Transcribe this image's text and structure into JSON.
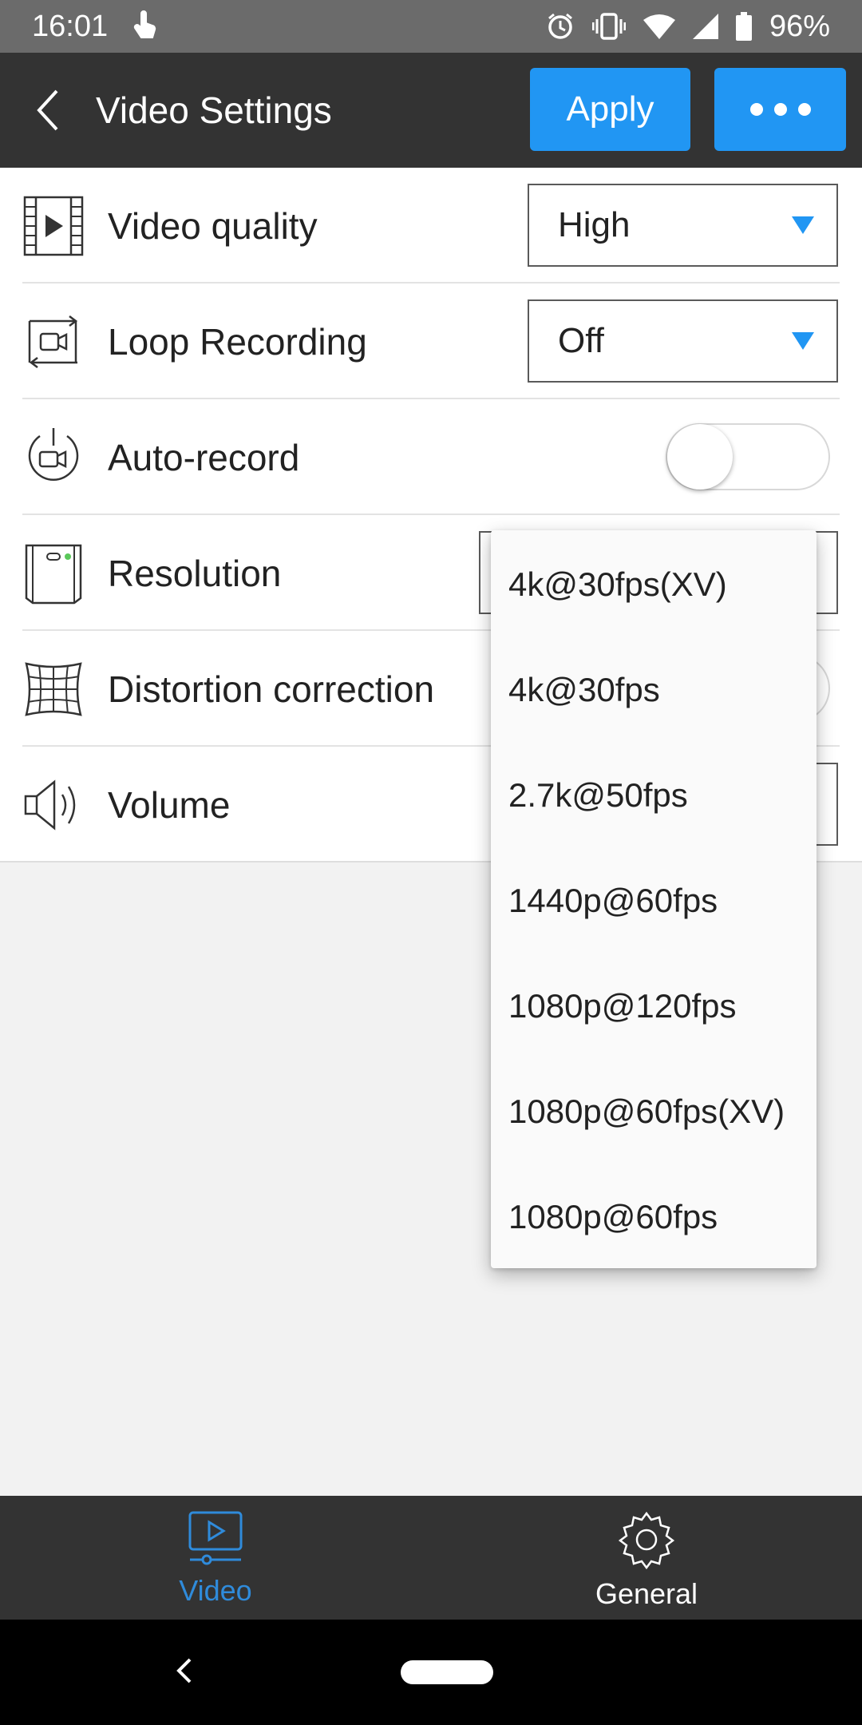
{
  "status_bar": {
    "time": "16:01",
    "battery": "96%",
    "icons": [
      "touch-icon",
      "alarm-icon",
      "vibrate-icon",
      "wifi-icon",
      "signal-icon",
      "battery-icon"
    ]
  },
  "header": {
    "title": "Video Settings",
    "apply_label": "Apply",
    "back_icon": "back-chevron-icon",
    "more_icon": "more-dots-icon"
  },
  "settings": {
    "video_quality": {
      "label": "Video quality",
      "value": "High",
      "icon": "film-icon"
    },
    "loop_recording": {
      "label": "Loop Recording",
      "value": "Off",
      "icon": "loop-camera-icon"
    },
    "auto_record": {
      "label": "Auto-record",
      "enabled": false,
      "icon": "power-camera-icon"
    },
    "resolution": {
      "label": "Resolution",
      "icon": "camera-device-icon"
    },
    "distortion_correction": {
      "label": "Distortion correction",
      "icon": "grid-distortion-icon"
    },
    "volume": {
      "label": "Volume",
      "icon": "speaker-icon"
    }
  },
  "resolution_dropdown": {
    "options": [
      "4k@30fps(XV)",
      "4k@30fps",
      "2.7k@50fps",
      "1440p@60fps",
      "1080p@120fps",
      "1080p@60fps(XV)",
      "1080p@60fps"
    ]
  },
  "tabs": {
    "video_label": "Video",
    "general_label": "General"
  },
  "colors": {
    "accent": "#2196f3",
    "header_bg": "#333333",
    "active_tab": "#2f8bdb",
    "status_bar_bg": "#6b6b6b"
  }
}
